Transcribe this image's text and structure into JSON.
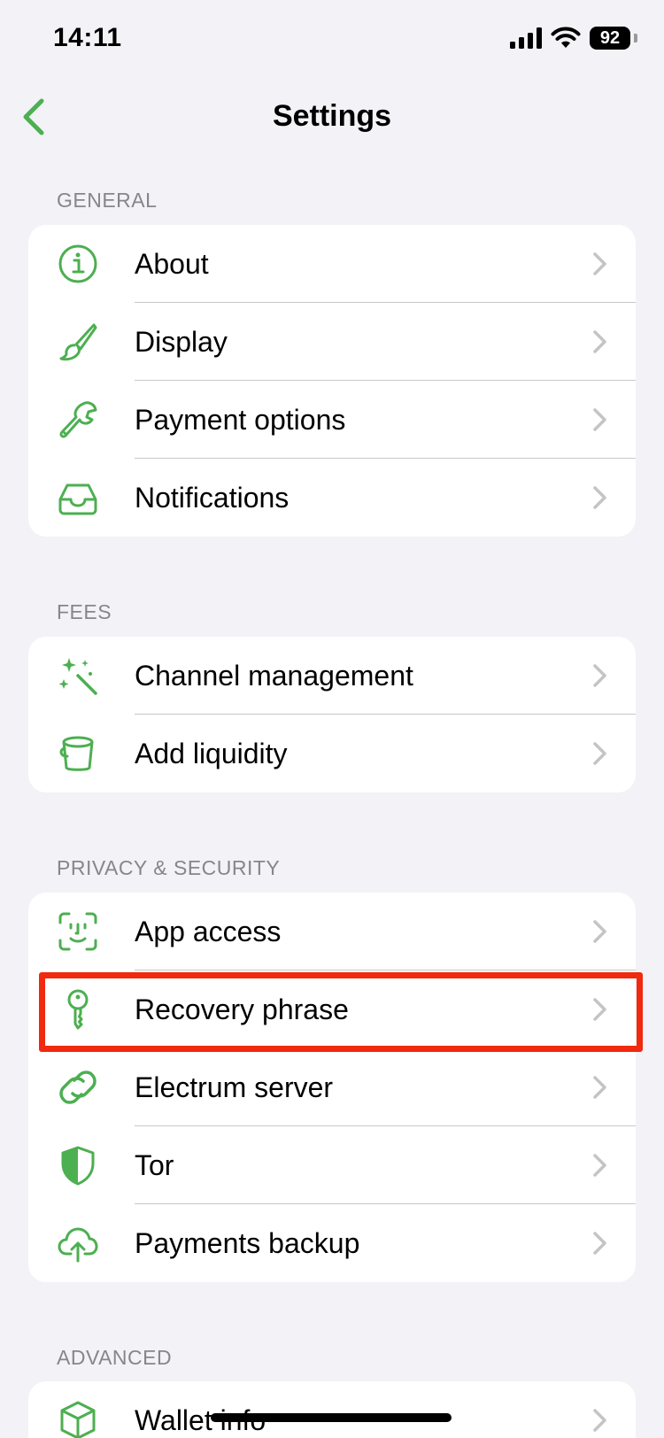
{
  "status_bar": {
    "time": "14:11",
    "battery": "92"
  },
  "nav": {
    "title": "Settings"
  },
  "colors": {
    "accent": "#4CAF50",
    "background": "#F2F2F7",
    "highlight": "#F0290F"
  },
  "sections": [
    {
      "header": "GENERAL",
      "items": [
        {
          "label": "About",
          "icon": "info-icon"
        },
        {
          "label": "Display",
          "icon": "paintbrush-icon"
        },
        {
          "label": "Payment options",
          "icon": "wrench-icon"
        },
        {
          "label": "Notifications",
          "icon": "tray-icon"
        }
      ]
    },
    {
      "header": "FEES",
      "items": [
        {
          "label": "Channel management",
          "icon": "magic-wand-icon"
        },
        {
          "label": "Add liquidity",
          "icon": "bucket-icon"
        }
      ]
    },
    {
      "header": "PRIVACY & SECURITY",
      "items": [
        {
          "label": "App access",
          "icon": "face-id-icon"
        },
        {
          "label": "Recovery phrase",
          "icon": "key-icon"
        },
        {
          "label": "Electrum server",
          "icon": "link-icon"
        },
        {
          "label": "Tor",
          "icon": "shield-icon"
        },
        {
          "label": "Payments backup",
          "icon": "cloud-upload-icon"
        }
      ]
    },
    {
      "header": "ADVANCED",
      "items": [
        {
          "label": "Wallet info",
          "icon": "cube-icon"
        }
      ]
    }
  ]
}
